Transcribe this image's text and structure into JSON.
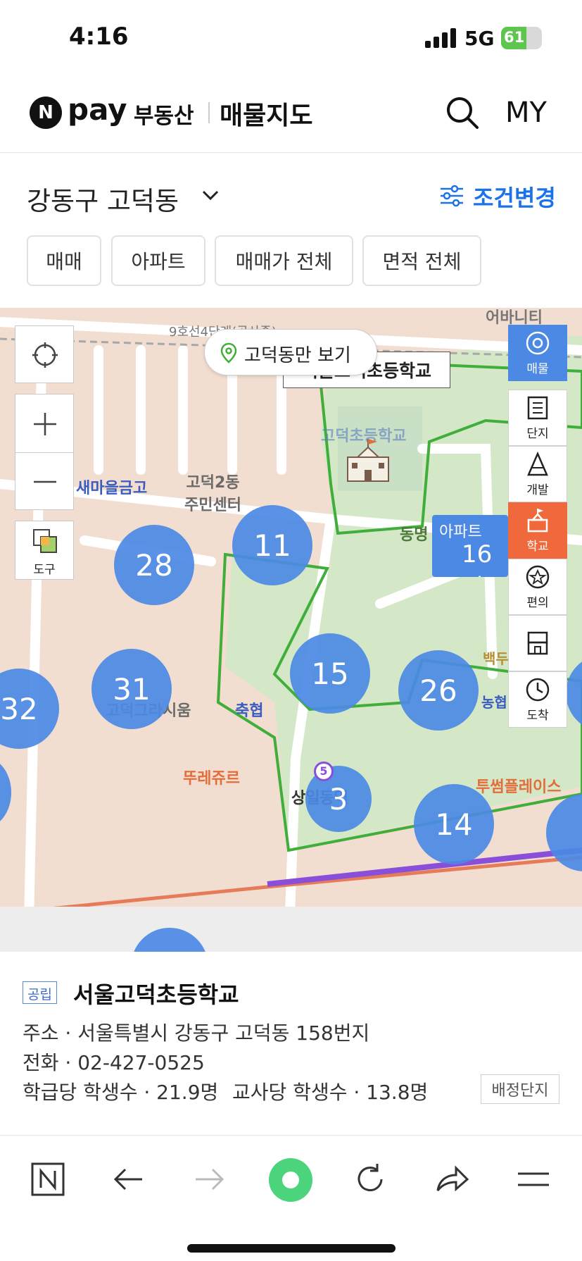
{
  "status_bar": {
    "time": "4:16",
    "network": "5G",
    "battery": "61"
  },
  "header": {
    "logo_n": "N",
    "logo_pay": "pay",
    "logo_realestate": "부동산",
    "page_title": "매물지도",
    "my_label": "MY"
  },
  "filters": {
    "region": "강동구 고덕동",
    "condition_label": "조건변경",
    "chips": [
      "매매",
      "아파트",
      "매매가 전체",
      "면적 전체"
    ]
  },
  "map": {
    "only_area_button": "고덕동만 보기",
    "school_tooltip": "서울고덕초등학교",
    "tool_label": "도구",
    "side_buttons": [
      {
        "label": "매물",
        "icon": "listing-icon",
        "state": "active-blue"
      },
      {
        "label": "단지",
        "icon": "complex-icon",
        "state": "normal"
      },
      {
        "label": "개발",
        "icon": "development-icon",
        "state": "normal"
      },
      {
        "label": "학교",
        "icon": "school-icon",
        "state": "active-orange"
      },
      {
        "label": "편의",
        "icon": "convenience-icon",
        "state": "normal"
      },
      {
        "label": "중개",
        "icon": "agent-icon",
        "state": "normal"
      },
      {
        "label": "도착",
        "icon": "arrival-clock-icon",
        "state": "normal"
      }
    ],
    "clusters": [
      {
        "count": "11"
      },
      {
        "count": "28"
      },
      {
        "count": "15"
      },
      {
        "count": "26"
      },
      {
        "count": "31"
      },
      {
        "count": "32"
      },
      {
        "count": "3"
      },
      {
        "count": "14"
      }
    ],
    "listing_bubble": {
      "type": "아파트",
      "price": "16억"
    },
    "places": {
      "bank1": "새마을금고",
      "community_center": "고덕2동\n주민센터",
      "bank2": "축협",
      "apartment": "고덕그라시움",
      "cafe": "뚜레쥬르",
      "station": "상일동역",
      "mall": "투썸플레이스",
      "park": "동명",
      "school_map_label": "고덕초등학교",
      "road": "9호선4단계(공사중)",
      "university": "어바니티",
      "bank3": "농협",
      "sports": "백두요양센터"
    }
  },
  "school_info": {
    "type_badge": "공립",
    "name": "서울고덕초등학교",
    "address": "주소 · 서울특별시 강동구 고덕동 158번지",
    "phone": "전화 · 02-427-0525",
    "students_per_class": "학급당 학생수 · 21.9명",
    "students_per_teacher": "교사당 학생수 · 13.8명",
    "assign_button": "배정단지"
  },
  "colors": {
    "accent_blue": "#1a73e8",
    "cluster_blue": "#4b89e4",
    "active_orange": "#f0693c",
    "boundary_green": "#3fae3a"
  }
}
